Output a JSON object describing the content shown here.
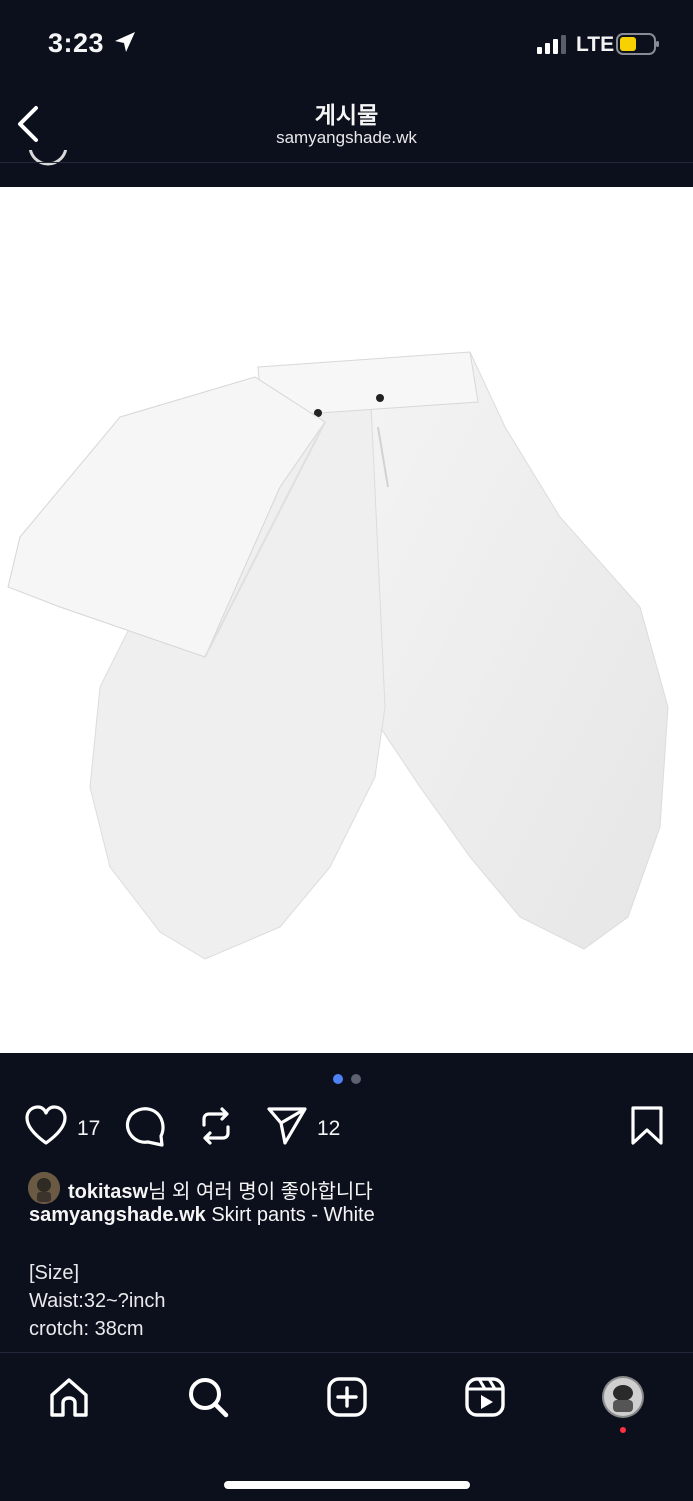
{
  "status_bar": {
    "time": "3:23",
    "network": "LTE"
  },
  "header": {
    "title": "게시물",
    "subtitle": "samyangshade.wk"
  },
  "post": {
    "image_alt": "White skirt pants",
    "carousel": {
      "count": 2,
      "active": 1
    },
    "actions": {
      "like_count": "17",
      "share_count": "12"
    },
    "liked_by": {
      "user": "tokitasw",
      "suffix": "님 외 여러 명이 좋아합니다"
    },
    "caption": {
      "username": "samyangshade.wk",
      "text": "Skirt pants - White",
      "lines": [
        "[Size]",
        "Waist:32~?inch",
        "crotch: 38cm"
      ]
    }
  },
  "colors": {
    "background": "#0c0f1c",
    "accent": "#4f82f7",
    "notification": "#ff3040"
  },
  "icons": {
    "tabs": [
      "home-icon",
      "search-icon",
      "create-icon",
      "reels-icon",
      "profile-avatar"
    ]
  }
}
